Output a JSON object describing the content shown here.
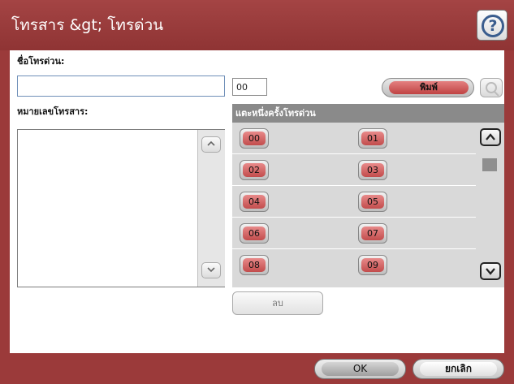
{
  "title": "โทรสาร &gt; โทรด่วน",
  "help_icon": "help-icon",
  "fax_name_label": "ชื่อโทรด่วน:",
  "fax_name_value": "",
  "speed_number_value": "00",
  "print_label": "พิมพ์",
  "fax_numbers_label": "หมายเลขโทรสาร:",
  "speed_dial_header": "แตะหนึ่งครั้งโทรด่วน",
  "speed_dials": [
    [
      "00",
      "01"
    ],
    [
      "02",
      "03"
    ],
    [
      "04",
      "05"
    ],
    [
      "06",
      "07"
    ],
    [
      "08",
      "09"
    ]
  ],
  "delete_label": "ลบ",
  "ok_label": "OK",
  "cancel_label": "ยกเลิก",
  "colors": {
    "accent": "#9b3a3a",
    "button_red": "#c24c4c",
    "header_gray": "#8a8a8a"
  }
}
